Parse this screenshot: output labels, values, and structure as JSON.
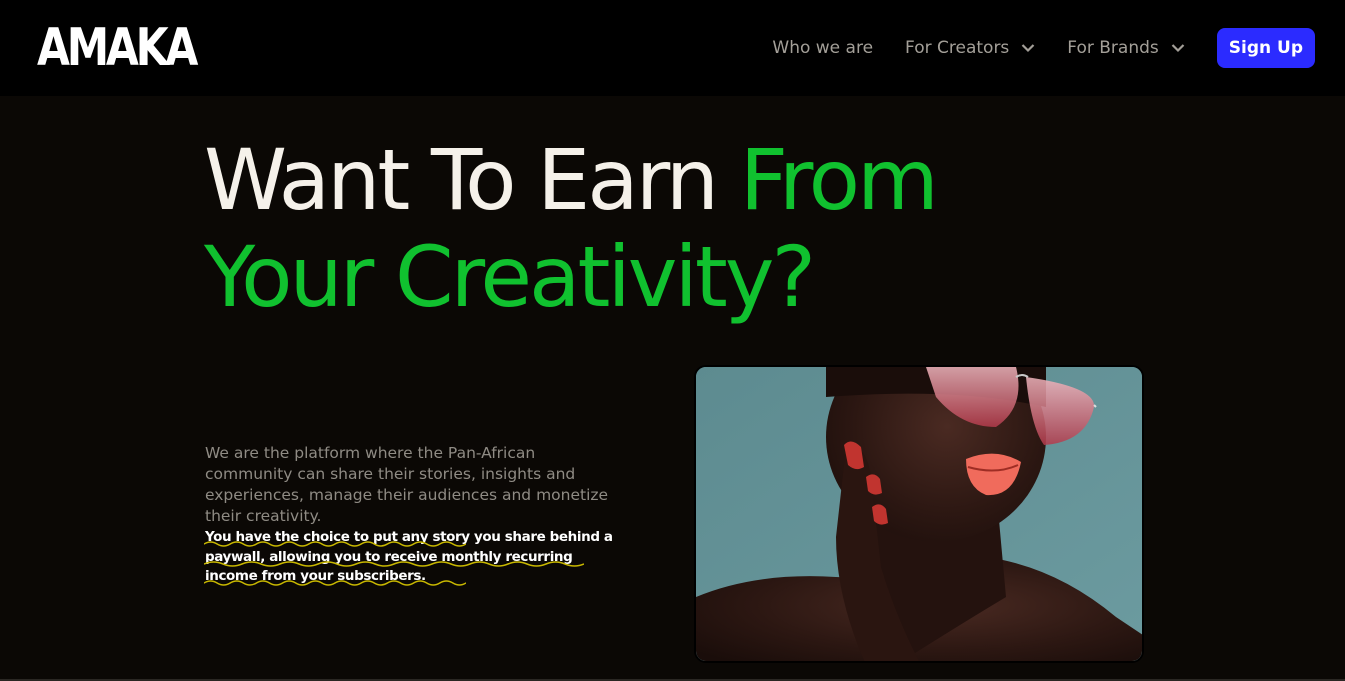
{
  "header": {
    "logo": "AMAKA",
    "nav": [
      {
        "label": "Who we are",
        "has_dropdown": false
      },
      {
        "label": "For Creators",
        "has_dropdown": true
      },
      {
        "label": "For Brands",
        "has_dropdown": true
      }
    ],
    "signup_label": "Sign Up"
  },
  "hero": {
    "headline_white": "Want To Earn ",
    "headline_green_1": "From",
    "headline_green_2": "Your Creativity?",
    "description": "We are the platform where the Pan-African community can share their stories, insights and experiences, manage their audiences and monetize their creativity.",
    "highlight": "You have the choice to put any story you share behind a paywall, allowing you to receive monthly recurring income from your subscribers.",
    "image_icon": "woman-red-sunglasses-photo"
  },
  "colors": {
    "accent_green": "#10c12f",
    "signup_blue": "#2b2bff",
    "background": "#0b0805",
    "squiggle_yellow": "#c9b800"
  }
}
